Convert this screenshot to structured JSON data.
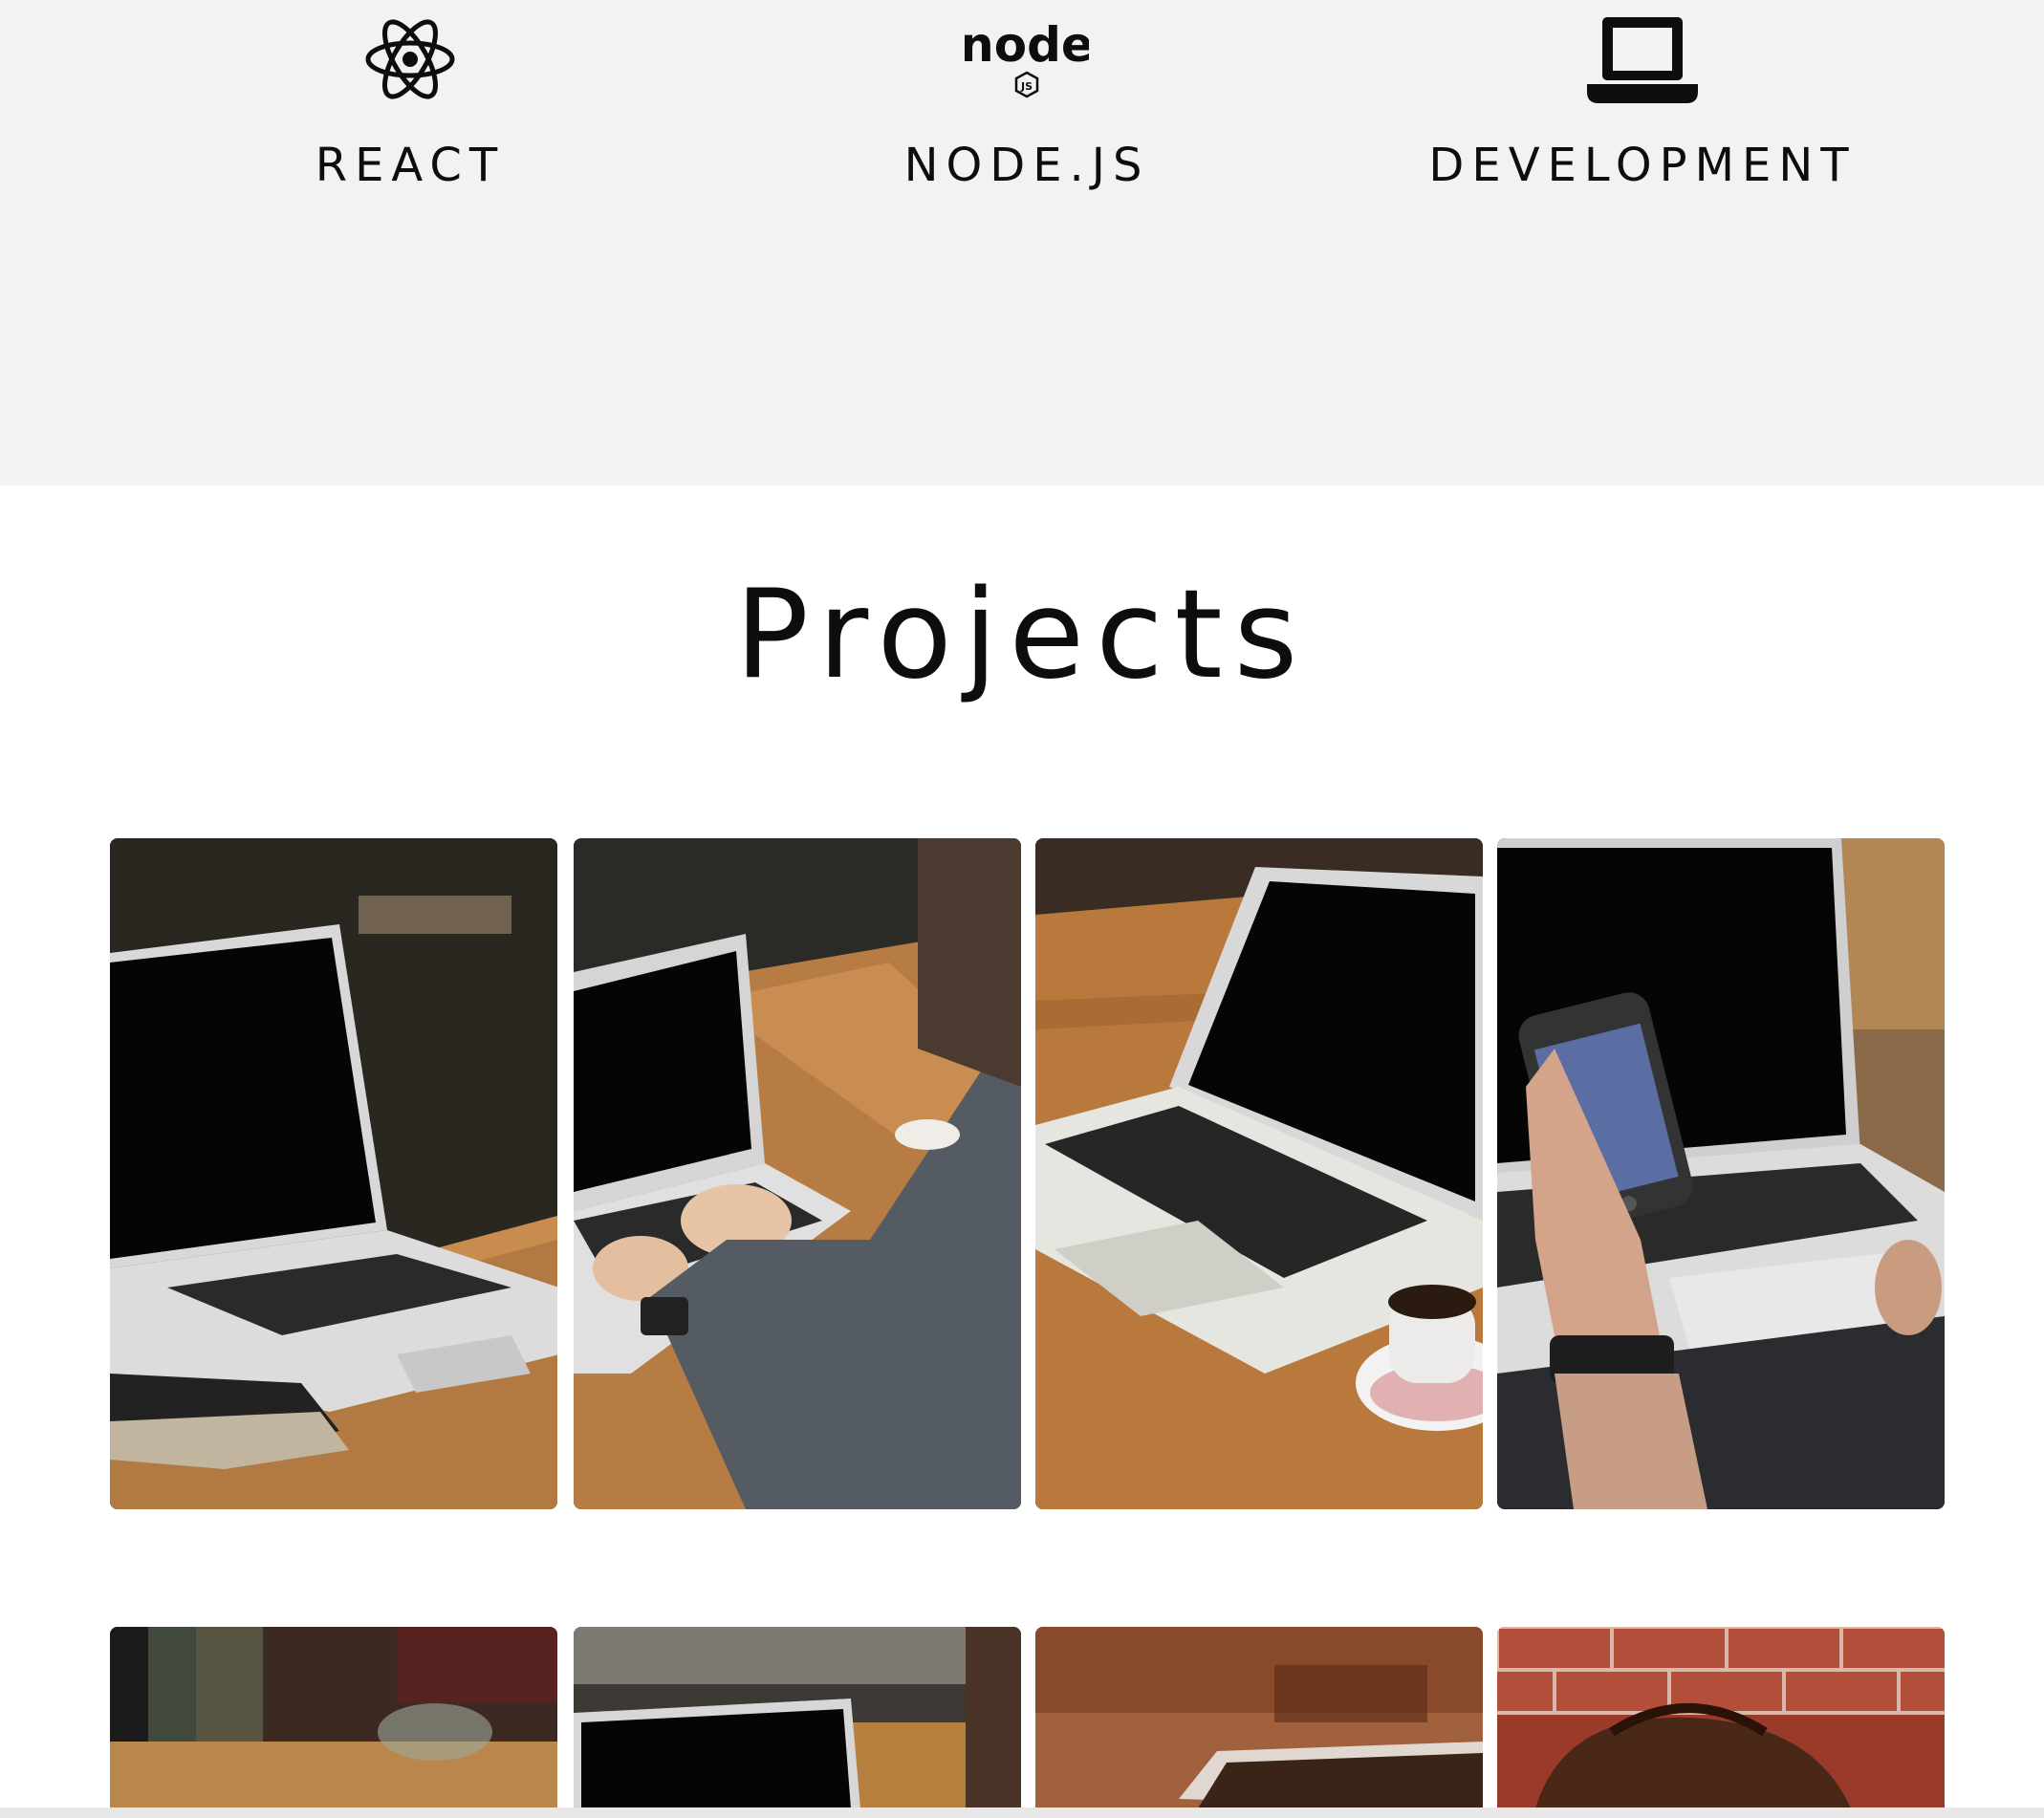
{
  "skills": [
    {
      "label": "REACT",
      "icon": "react-atom-icon"
    },
    {
      "label": "NODE.JS",
      "icon": "nodejs-logo-icon",
      "logo_text": "node",
      "logo_badge": "JS"
    },
    {
      "label": "DEVELOPMENT",
      "icon": "laptop-icon"
    }
  ],
  "projects": {
    "title": "Projects",
    "cards": [
      {
        "image": "laptop-on-wooden-table-with-notebook"
      },
      {
        "image": "person-typing-on-laptop"
      },
      {
        "image": "laptop-with-coffee-cup"
      },
      {
        "image": "hand-holding-phone-over-laptop"
      },
      {
        "image": "blurred-laptop-corner"
      },
      {
        "image": "laptop-on-table-top-view"
      },
      {
        "image": "laptop-warm-background"
      },
      {
        "image": "leather-bag-brick-wall"
      }
    ]
  },
  "colors": {
    "skills_background": "#f2f2f2",
    "page_background": "#ffffff",
    "text": "#0d0d0d"
  }
}
